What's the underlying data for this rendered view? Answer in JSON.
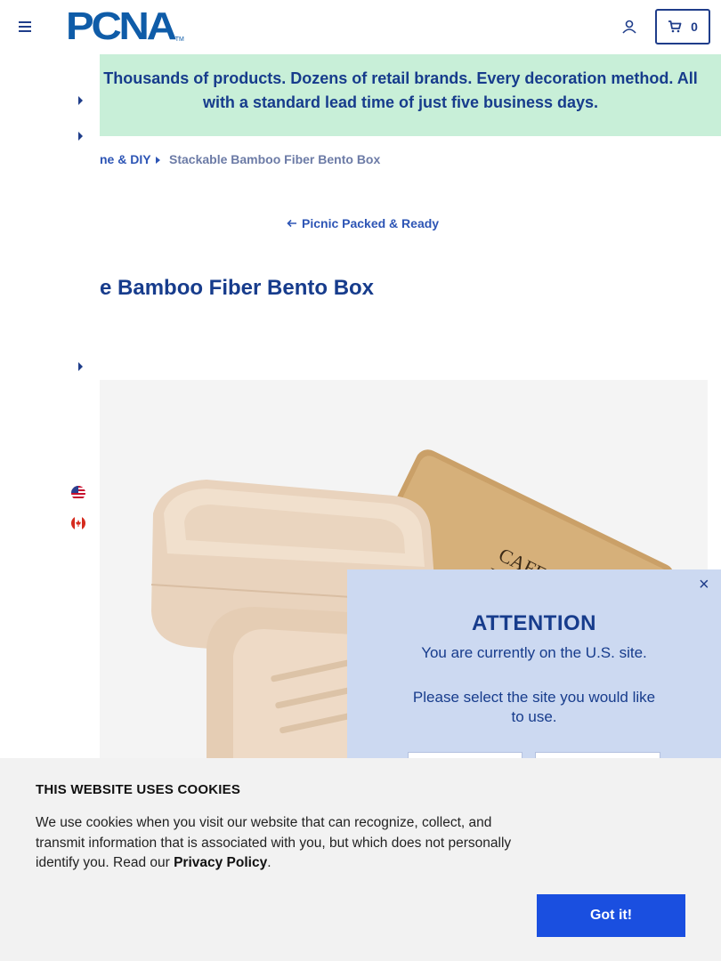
{
  "header": {
    "logo_text": "PCNA",
    "logo_tm": "TM",
    "cart_count": "0"
  },
  "banner": {
    "text": "Thousands of products. Dozens of retail brands. Every decoration method. All with a standard lead time of just five business days."
  },
  "breadcrumb": {
    "parent": "ne & DIY",
    "current": "Stackable Bamboo Fiber Bento Box"
  },
  "back_link": {
    "label": "Picnic Packed & Ready"
  },
  "product": {
    "title": "e Bamboo Fiber Bento Box",
    "lid_engraving": "CAFE NEKO"
  },
  "modal": {
    "close": "×",
    "title": "ATTENTION",
    "line1": "You are currently on the U.S. site.",
    "line2": "Please select the site you would like to use."
  },
  "cookie": {
    "title": "THIS WEBSITE USES COOKIES",
    "text_before": "We use cookies when you visit our website that can recognize, collect, and transmit information that is associated with you, but which does not personally identify you. Read our ",
    "link": "Privacy Policy",
    "text_after": ".",
    "button": "Got it!"
  },
  "colors": {
    "navy": "#173c8c",
    "banner_bg": "#c8efd8",
    "modal_bg": "#ccd9f1",
    "cookie_button": "#1a4fe0"
  },
  "icons": [
    "menu-icon",
    "account-icon",
    "cart-icon",
    "caret-right-icon",
    "us-flag-icon",
    "ca-flag-icon",
    "back-arrow-icon",
    "close-icon"
  ]
}
